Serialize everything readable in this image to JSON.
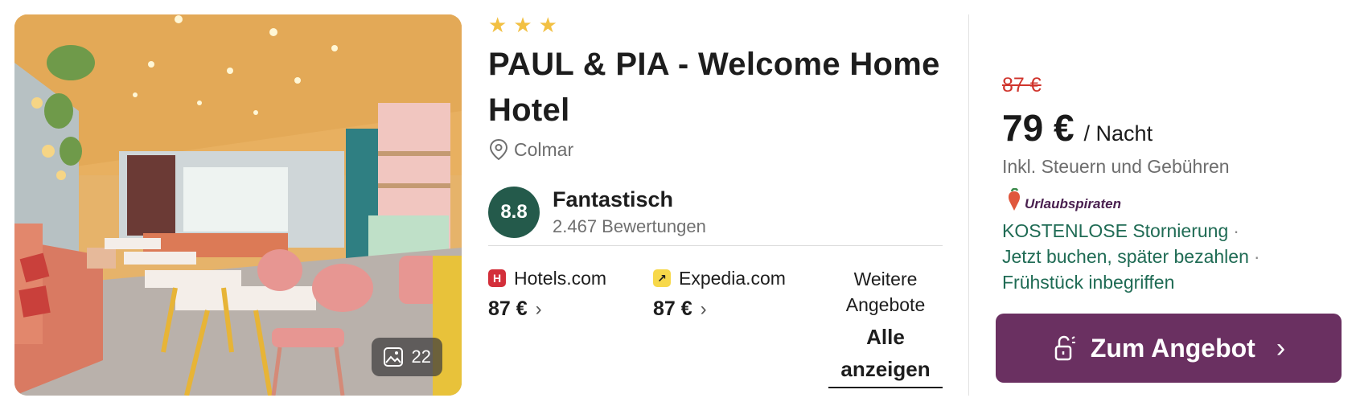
{
  "hotel": {
    "stars": 3,
    "name": "PAUL & PIA - Welcome Home Hotel",
    "location": "Colmar",
    "rating": {
      "score": "8.8",
      "label": "Fantastisch",
      "reviews": "2.467 Bewertungen"
    },
    "photo_count": "22"
  },
  "providers": [
    {
      "name": "Hotels.com",
      "price": "87 €",
      "logo_color": "#d32f3a",
      "logo_glyph": "H"
    },
    {
      "name": "Expedia.com",
      "price": "87 €",
      "logo_color": "#f7d84a",
      "logo_glyph": "↗"
    }
  ],
  "more_offers": {
    "label": "Weitere Angebote",
    "link": "Alle anzeigen"
  },
  "deal": {
    "old_price": "87 €",
    "price": "79 €",
    "per": "/ Nacht",
    "tax_note": "Inkl. Steuern und Gebühren",
    "partner": "Urlaubspiraten",
    "benefits": [
      "KOSTENLOSE Stornierung",
      "Jetzt buchen, später bezahlen",
      "Frühstück inbegriffen"
    ],
    "benefit_separator": "·",
    "cta": "Zum Angebot"
  },
  "colors": {
    "score_badge": "#245a4b",
    "old_price": "#d0342c",
    "benefits": "#1f6b54",
    "cta": "#6a3061",
    "stars": "#f2c042"
  },
  "icons": {
    "star": "star-icon",
    "location": "location-pin-icon",
    "gallery": "image-gallery-icon",
    "chevron": "chevron-right-icon",
    "unlock": "unlock-icon",
    "partner": "urlaubspiraten-logo"
  }
}
